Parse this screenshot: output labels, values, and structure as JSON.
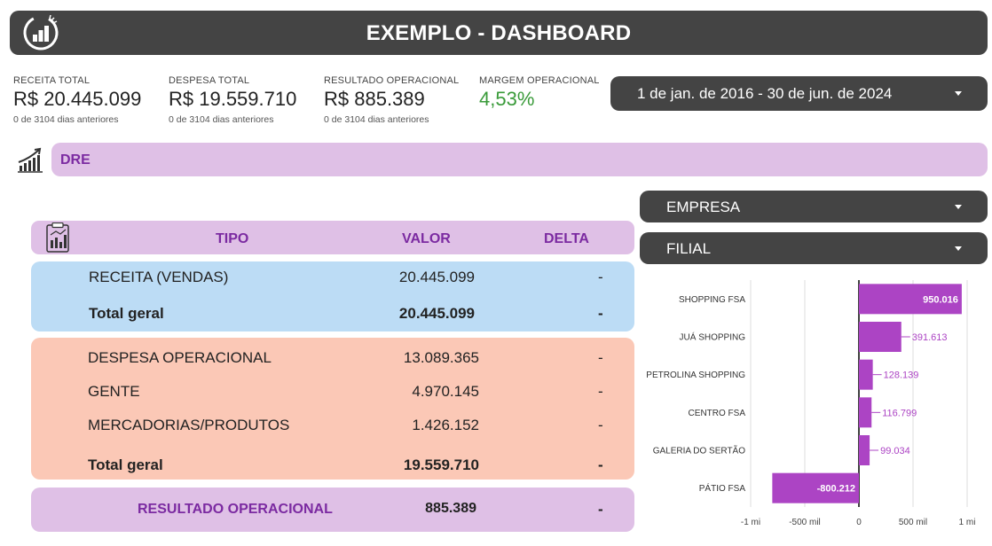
{
  "header": {
    "title": "EXEMPLO - DASHBOARD",
    "logo_icon": "bar-chart-circle-icon"
  },
  "kpis": [
    {
      "label": "RECEITA TOTAL",
      "value": "R$ 20.445.099",
      "sub": "0 de 3104 dias anteriores"
    },
    {
      "label": "DESPESA TOTAL",
      "value": "R$ 19.559.710",
      "sub": "0 de 3104 dias anteriores"
    },
    {
      "label": "RESULTADO OPERACIONAL",
      "value": "R$ 885.389",
      "sub": "0 de 3104 dias anteriores"
    },
    {
      "label": "MARGEM OPERACIONAL",
      "value": "4,53%",
      "color": "#3a9b3a"
    }
  ],
  "date_range": {
    "label": "1 de jan. de 2016 - 30 de jun. de 2024",
    "icon": "dropdown-caret-icon"
  },
  "section": {
    "title": "DRE",
    "icon": "growth-chart-icon"
  },
  "filters": {
    "empresa": "EMPRESA",
    "filial": "FILIAL"
  },
  "table": {
    "icon": "report-clipboard-icon",
    "headers": {
      "tipo": "TIPO",
      "valor": "VALOR",
      "delta": "DELTA"
    },
    "receita": {
      "rows": [
        {
          "tipo": "RECEITA (VENDAS)",
          "valor": "20.445.099",
          "delta": "-"
        }
      ],
      "total": {
        "tipo": "Total geral",
        "valor": "20.445.099",
        "delta": "-"
      }
    },
    "despesa": {
      "rows": [
        {
          "tipo": "DESPESA OPERACIONAL",
          "valor": "13.089.365",
          "delta": "-"
        },
        {
          "tipo": "GENTE",
          "valor": "4.970.145",
          "delta": "-"
        },
        {
          "tipo": "MERCADORIAS/PRODUTOS",
          "valor": "1.426.152",
          "delta": "-"
        }
      ],
      "total": {
        "tipo": "Total geral",
        "valor": "19.559.710",
        "delta": "-"
      }
    },
    "resultado": {
      "tipo": "RESULTADO OPERACIONAL",
      "valor": "885.389",
      "delta": "-"
    }
  },
  "colors": {
    "dark": "#444444",
    "purple_bg": "#dfc0e6",
    "purple_text": "#7b2aa1",
    "blue_bg": "#bcdcf5",
    "salmon_bg": "#fbc8b6",
    "bar": "#ac44c4"
  },
  "chart_data": {
    "type": "bar",
    "orientation": "horizontal",
    "categories": [
      "SHOPPING FSA",
      "JUÁ SHOPPING",
      "PETROLINA SHOPPING",
      "CENTRO FSA",
      "GALERIA DO SERTÃO",
      "PÁTIO FSA"
    ],
    "values": [
      950016,
      391613,
      128139,
      116799,
      99034,
      -800212
    ],
    "value_labels": [
      "950.016",
      "391.613",
      "128.139",
      "116.799",
      "99.034",
      "-800.212"
    ],
    "xlim": [
      -1000000,
      1000000
    ],
    "xticks": [
      -1000000,
      -500000,
      0,
      500000,
      1000000
    ],
    "xtick_labels": [
      "-1 mi",
      "-500 mil",
      "0",
      "500 mil",
      "1 mi"
    ],
    "grid": true,
    "title": "",
    "xlabel": "",
    "ylabel": ""
  }
}
